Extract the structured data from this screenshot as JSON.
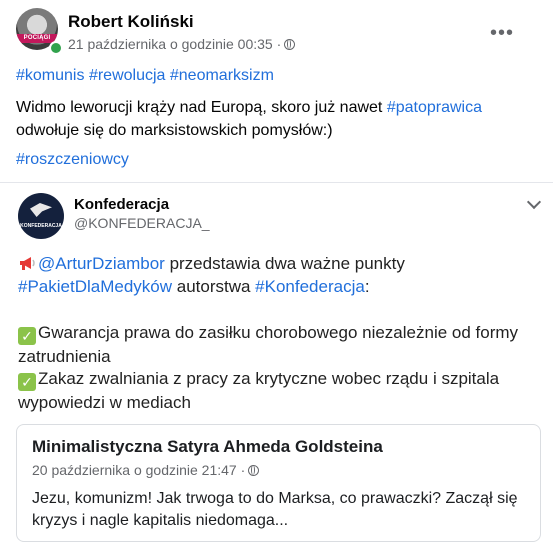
{
  "post": {
    "author": "Robert Koliński",
    "avatar_badge": "POCIĄGI",
    "timestamp": "21 października o godzinie 00:35 ·",
    "privacy_icon": "globe-icon",
    "more_label": "•••",
    "hashtags_line": [
      "#komunis",
      "#rewolucja",
      "#neomarksizm"
    ],
    "body_part1": "Widmo leworucji krąży nad Europą, skoro już nawet ",
    "body_tag": "#patoprawica",
    "body_part2": "odwołuje się do marksistowskich pomysłów:)",
    "tag_line2": "#roszczeniowcy"
  },
  "shared": {
    "page_name": "Konfederacja",
    "handle": "@KONFEDERACJA_",
    "avatar_label": "KONFEDERACJA",
    "line1_mention": "@ArturDziambor",
    "line1_text": " przedstawia dwa ważne punkty",
    "line2_tag1": "#PakietDlaMedyków",
    "line2_text": " autorstwa ",
    "line2_tag2": "#Konfederacja",
    "line2_end": ":",
    "point1_a": "Gwarancja prawa do zasiłku chorobowego niezależnie od formy",
    "point1_b": "zatrudnienia",
    "point2_a": "Zakaz zwalniania z pracy za krytyczne wobec rządu i szpitala",
    "point2_b": "wypowiedzi w mediach",
    "check_glyph": "✓"
  },
  "quoted": {
    "title": "Minimalistyczna Satyra Ahmeda Goldsteina",
    "timestamp": "20 października o godzinie 21:47 ·",
    "text": "Jezu, komunizm! Jak trwoga to do Marksa, co prawaczki? Zaczął się kryzys i nagle kapitalis niedomaga..."
  },
  "colors": {
    "link": "#216fdb",
    "online": "#31a24c",
    "check": "#8bc34a"
  }
}
